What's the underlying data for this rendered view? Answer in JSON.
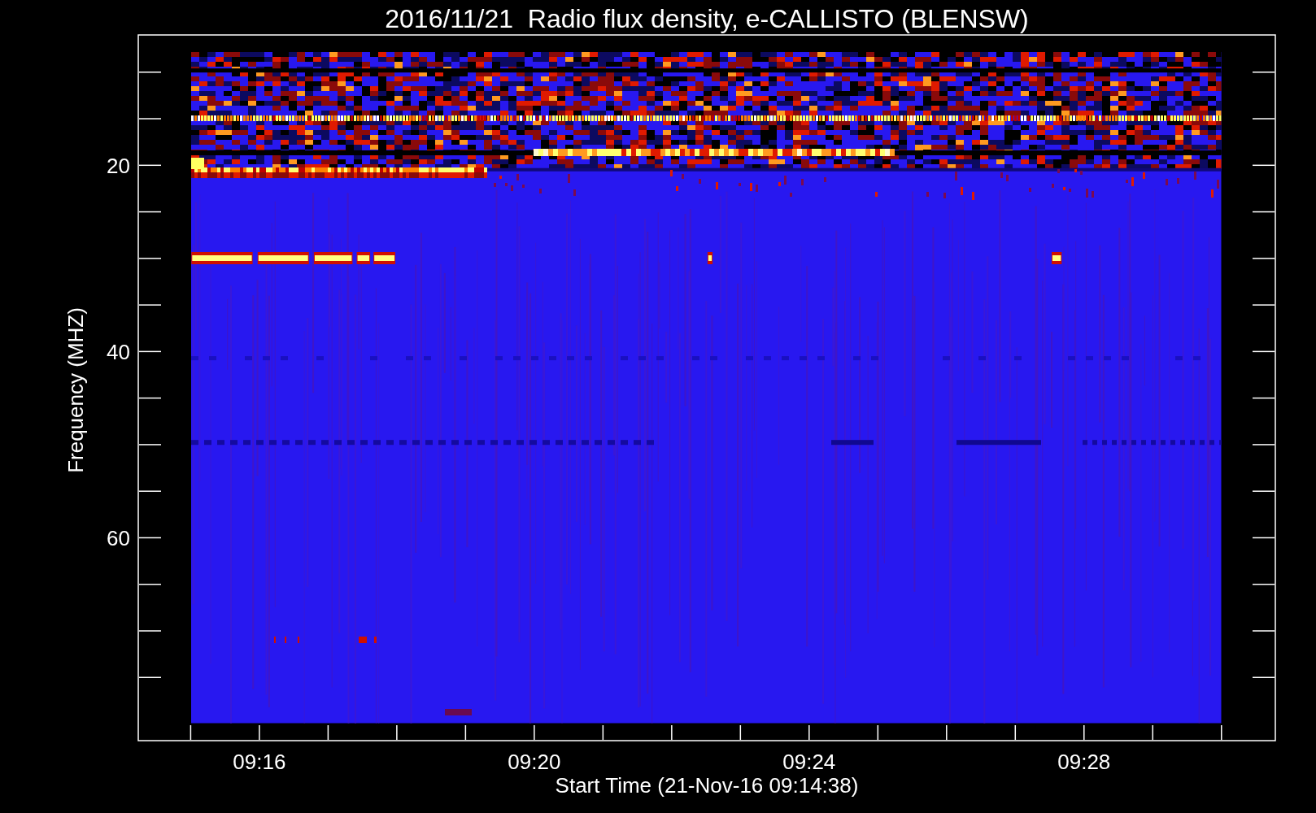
{
  "plot": {
    "title": "2016/11/21  Radio flux density, e-CALLISTO (BLENSW)",
    "ylabel": "Frequency (MHZ)",
    "xlabel": "Start Time (21-Nov-16 09:14:38)",
    "y_tick_labels": [
      "20",
      "40",
      "60"
    ],
    "x_tick_labels": [
      "09:16",
      "09:20",
      "09:24",
      "09:28"
    ]
  }
}
